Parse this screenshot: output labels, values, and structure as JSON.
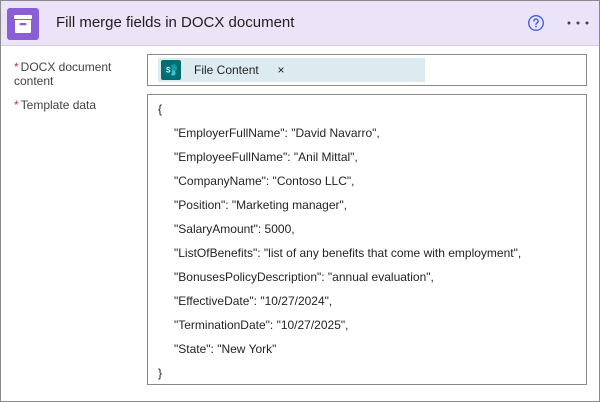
{
  "header": {
    "title": "Fill merge fields in DOCX document",
    "app_icon": "archive-box-icon",
    "help_icon": "help-circle-icon",
    "more_icon": "more-ellipsis-icon",
    "accent_color": "#8a5fd5",
    "header_bg": "#ebe3f7"
  },
  "fields": {
    "docx": {
      "required_mark": "*",
      "label": "DOCX document content",
      "token": {
        "label": "File Content",
        "close": "×",
        "icon": "sharepoint-icon"
      }
    },
    "template": {
      "required_mark": "*",
      "label": "Template data",
      "lines": [
        "{",
        "\"EmployerFullName\": \"David Navarro\",",
        "\"EmployeeFullName\": \"Anil Mittal\",",
        "\"CompanyName\": \"Contoso LLC\",",
        "\"Position\": \"Marketing manager\",",
        "\"SalaryAmount\": 5000,",
        "\"ListOfBenefits\": \"list of any benefits that come with employment\",",
        "\"BonusesPolicyDescription\": \"annual evaluation\",",
        "\"EffectiveDate\": \"10/27/2024\",",
        "\"TerminationDate\": \"10/27/2025\",",
        "\"State\": \"New York\"",
        "}"
      ]
    }
  }
}
